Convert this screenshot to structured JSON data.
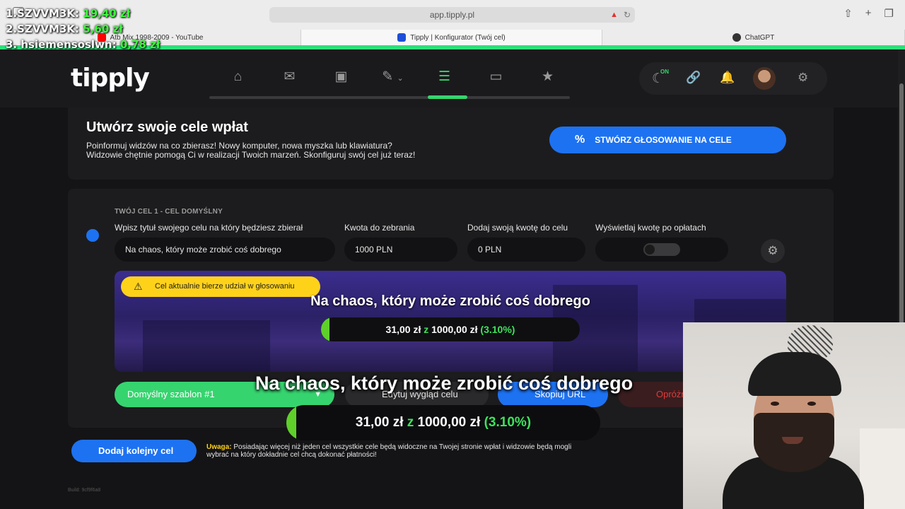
{
  "ranking": [
    {
      "name": "1.SZVVM3K:",
      "amount": "19,40 zł"
    },
    {
      "name": "2.SZVVM3K:",
      "amount": "5,60 zł"
    },
    {
      "name": "3. hsiemensoslwn:",
      "amount": "0,78 zł"
    }
  ],
  "browser": {
    "url": "app.tipply.pl",
    "tabs": [
      {
        "label": "Atb Mix 1998-2009 - YouTube",
        "favicon_color": "#ff0000"
      },
      {
        "label": "Tipply | Konfigurator (Twój cel)",
        "favicon_color": "#1d4ed8"
      },
      {
        "label": "ChatGPT",
        "favicon_color": "#333333"
      }
    ]
  },
  "nav": {
    "logo": "tipply",
    "icons": [
      "home-icon",
      "inbox-icon",
      "wallet-icon",
      "edit-icon",
      "goals-icon",
      "window-icon",
      "star-icon"
    ],
    "active_index": 4,
    "night_mode_badge": "ON",
    "right_icons": [
      "moon-icon",
      "link-icon",
      "bell-icon",
      "avatar",
      "gear-icon"
    ]
  },
  "header": {
    "title": "Utwórz swoje cele wpłat",
    "description_line1": "Poinformuj widzów na co zbierasz! Nowy komputer, nowa myszka lub klawiatura?",
    "description_line2": "Widzowie chętnie pomogą Ci w realizacji Twoich marzeń. Skonfiguruj swój cel już teraz!",
    "vote_button": "STWÓRZ GŁOSOWANIE NA CELE"
  },
  "goal": {
    "heading": "TWÓJ CEL 1 - CEL DOMYŚLNY",
    "title_label": "Wpisz tytuł swojego celu na który będziesz zbierał",
    "title_value": "Na chaos, który może zrobić coś dobrego",
    "amount_label": "Kwota do zebrania",
    "amount_value": "1000 PLN",
    "own_label": "Dodaj swoją kwotę do celu",
    "own_value": "0 PLN",
    "fees_label": "Wyświetlaj kwotę po opłatach",
    "fees_enabled": false,
    "warning": "Cel aktualnie bierze udział w głosowaniu",
    "preview_title": "Na chaos, który może zrobić coś dobrego",
    "collected": "31,00 zł",
    "connector": "z",
    "target": "1000,00 zł",
    "percent": "(3.10%)",
    "progress": 0.031,
    "template_button": "Domyślny szablon #1",
    "edit_button": "Edytuj wygląd celu",
    "copy_button": "Skopiuj URL",
    "clear_button": "Opróżnij"
  },
  "footer": {
    "add_button": "Dodaj kolejny cel",
    "note_label": "Uwaga:",
    "note_text": "Posiadając więcej niż jeden cel wszystkie cele będą widoczne na Twojej stronie wpłat i widzowie będą mogli wybrać na który dokładnie cel chcą dokonać płatności!",
    "build": "Build: 9cf9f6a8"
  },
  "overlay": {
    "title": "Na chaos, który może zrobić coś dobrego",
    "collected": "31,00 zł",
    "connector": "z",
    "target": "1000,00 zł",
    "percent": "(3.10%)"
  },
  "colors": {
    "accent_green": "#36d46f",
    "accent_blue": "#1d72f2",
    "warning_yellow": "#ffd21a"
  }
}
